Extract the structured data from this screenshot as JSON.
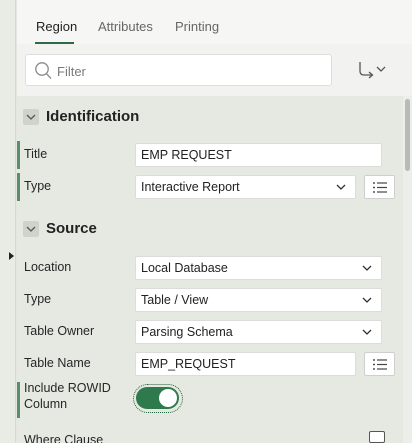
{
  "tabs": [
    {
      "label": "Region",
      "active": true
    },
    {
      "label": "Attributes",
      "active": false
    },
    {
      "label": "Printing",
      "active": false
    }
  ],
  "search": {
    "placeholder": "Filter",
    "value": ""
  },
  "icons": {
    "search": "search-icon",
    "goto": "go-to-group-icon",
    "collapse": "chevron-down-icon",
    "select": "chevron-down-icon",
    "lov": "list-of-values-icon",
    "code": "code-editor-icon",
    "side": "caret-right-icon"
  },
  "colors": {
    "accent": "#2f7a4c",
    "required_bar": "#5a8f6c"
  },
  "groups": {
    "identification": {
      "title": "Identification",
      "rows": {
        "title": {
          "label": "Title",
          "value": "EMP REQUEST"
        },
        "type": {
          "label": "Type",
          "value": "Interactive Report"
        }
      }
    },
    "source": {
      "title": "Source",
      "rows": {
        "location": {
          "label": "Location",
          "value": "Local Database"
        },
        "type": {
          "label": "Type",
          "value": "Table / View"
        },
        "table_owner": {
          "label": "Table Owner",
          "value": "Parsing Schema"
        },
        "table_name": {
          "label": "Table Name",
          "value": "EMP_REQUEST"
        },
        "include_rowid": {
          "label_line1": "Include ROWID",
          "label_line2": "Column",
          "on": true
        },
        "where_clause": {
          "label": "Where Clause"
        }
      }
    }
  }
}
